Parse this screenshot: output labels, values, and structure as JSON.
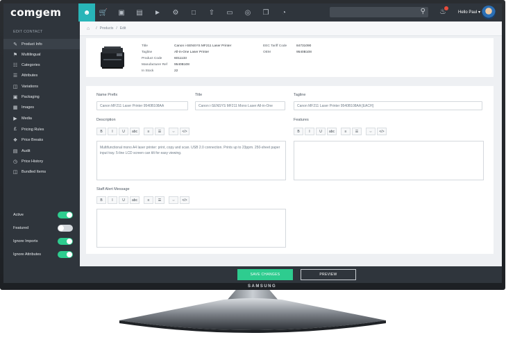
{
  "app": {
    "logo": "comgem",
    "greeting": "Hello Paul",
    "brand_label": "SAMSUNG"
  },
  "nav_icons": [
    "user-icon",
    "cart-icon",
    "briefcase-icon",
    "clipboard-icon",
    "megaphone-icon",
    "gear-icon",
    "folder-icon",
    "upload-icon",
    "monitor-icon",
    "globe-icon",
    "copy-icon",
    "pie-chart-icon"
  ],
  "breadcrumb": {
    "items": [
      "Products",
      "Edit"
    ]
  },
  "sidebar": {
    "title": "EDIT CONTACT",
    "items": [
      {
        "label": "Product Info",
        "icon": "edit-icon",
        "active": true
      },
      {
        "label": "Multilingual",
        "icon": "flag-icon"
      },
      {
        "label": "Categories",
        "icon": "sitemap-icon"
      },
      {
        "label": "Attributes",
        "icon": "list-icon"
      },
      {
        "label": "Variations",
        "icon": "variations-icon"
      },
      {
        "label": "Packaging",
        "icon": "box-icon"
      },
      {
        "label": "Images",
        "icon": "image-icon"
      },
      {
        "label": "Media",
        "icon": "media-icon"
      },
      {
        "label": "Pricing Rules",
        "icon": "pricing-icon"
      },
      {
        "label": "Price Breaks",
        "icon": "tag-icon"
      },
      {
        "label": "Audit",
        "icon": "audit-icon"
      },
      {
        "label": "Price History",
        "icon": "history-icon"
      },
      {
        "label": "Bundled Items",
        "icon": "bundle-icon"
      }
    ],
    "toggles": [
      {
        "label": "Active",
        "on": true
      },
      {
        "label": "Featured",
        "on": false
      },
      {
        "label": "Ignore Imports",
        "on": true
      },
      {
        "label": "Ignore Attributes",
        "on": true
      }
    ]
  },
  "product": {
    "left": [
      {
        "k": "Title",
        "v": "Canon i-SENSYS MF211 Laser Printer"
      },
      {
        "k": "Tagline",
        "v": "All-in-One Laser Printer"
      },
      {
        "k": "Product Code",
        "v": "6011133"
      },
      {
        "k": "Manufacturer Ref",
        "v": "9540B108"
      },
      {
        "k": "In Stock",
        "v": "22"
      }
    ],
    "right": [
      {
        "k": "EEC Tariff Code",
        "v": "84731090"
      },
      {
        "k": "OEM",
        "v": "9540B108"
      }
    ]
  },
  "form": {
    "name_prefix": {
      "label": "Name Prefix",
      "value": "Canon MF211 Laser Printer 9540B108AA"
    },
    "title": {
      "label": "Title",
      "value": "Canon i-SENSYS MF211 Mono Laser All-in-One"
    },
    "tagline": {
      "label": "Tagline",
      "value": "Canon MF211 Laser Printer 9540B108AA [EACH]"
    },
    "description": {
      "label": "Description",
      "text": "Multifunctional mono A4 laser printer: print, copy and scan. USB 2.0 connection. Prints up to 23ppm. 250-sheet paper input tray. 5-line LCD screen can tilt for easy viewing."
    },
    "features": {
      "label": "Features",
      "text": ""
    },
    "staff_alert": {
      "label": "Staff Alert Message",
      "text": ""
    },
    "toolbar": [
      "B",
      "I",
      "U",
      "abc",
      "≡",
      "☰",
      "⇔",
      "</>"
    ]
  },
  "actions": {
    "save": "SAVE CHANGES",
    "preview": "PREVIEW"
  },
  "colors": {
    "accent": "#28b5b8",
    "success": "#2ecc8f",
    "dark": "#2f353c"
  }
}
